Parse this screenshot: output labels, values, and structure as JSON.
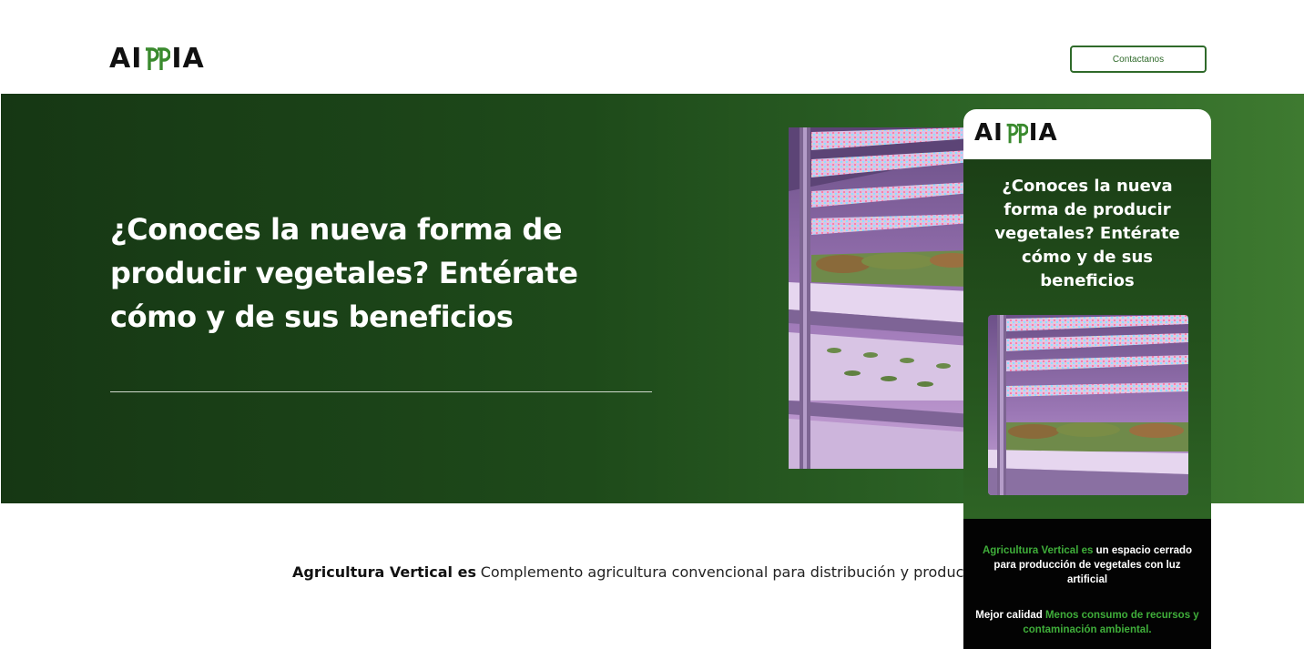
{
  "header": {
    "logo": {
      "left": "AI",
      "right": "IA",
      "middle_icon": "double-leaf-p-mark",
      "middle_color": "#3a8a2e"
    },
    "contact_button": "Contactanos"
  },
  "hero": {
    "title": "¿Conoces la nueva forma de producir vegetales? Entérate cómo y de sus beneficios",
    "image": "vertical-farm-photo"
  },
  "phone": {
    "logo": {
      "left": "AI",
      "right": "IA"
    },
    "title": "¿Conoces la nueva forma de producir vegetales? Entérate cómo y de sus beneficios",
    "image": "vertical-farm-photo",
    "p1_green": "Agricultura Vertical es",
    "p1_white": " un espacio cerrado para producción de vegetales con luz artificial",
    "p2_white": "Mejor calidad",
    "p2_green": " Menos consumo de recursos y contaminación ambiental."
  },
  "definition": {
    "term": "Agricultura Vertical es",
    "text": "Complemento agricultura convencional para distribución y producción"
  },
  "colors": {
    "brand_green": "#2f6a2a",
    "accent_green": "#3fae3a",
    "hero_dark": "#163714",
    "hero_light": "#3e7a30"
  }
}
